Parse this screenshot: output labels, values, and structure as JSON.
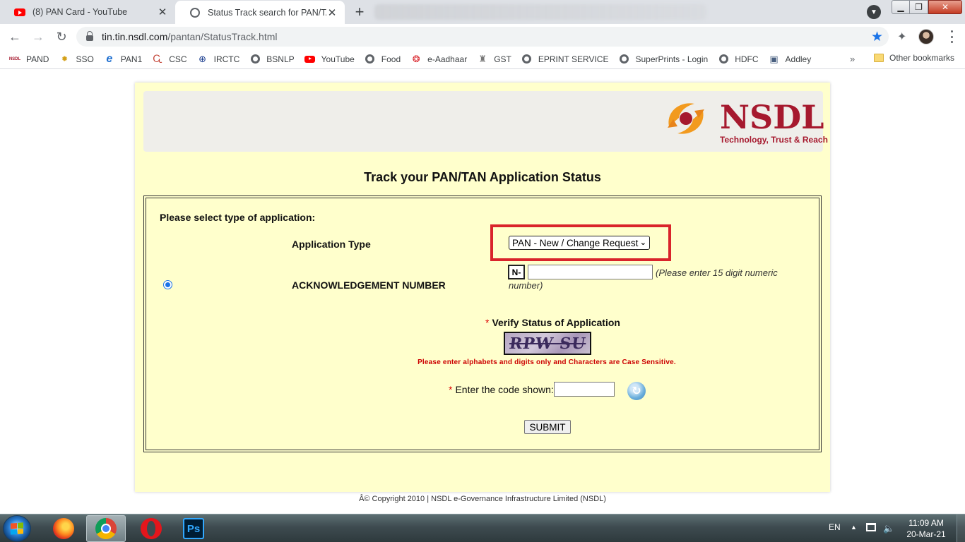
{
  "browser": {
    "tabs": [
      {
        "title": "(8) PAN Card - YouTube",
        "icon": "youtube-icon",
        "active": false
      },
      {
        "title": "Status Track search for PAN/TAN",
        "icon": "globe-icon",
        "active": true
      }
    ],
    "new_tab_symbol": "+",
    "close_symbol": "✕",
    "url_host": "tin.tin.nsdl.com",
    "url_path": "/pantan/StatusTrack.html",
    "bookmarks": [
      {
        "label": "PAND",
        "icon": "nsdl-icon"
      },
      {
        "label": "SSO",
        "icon": "emblem-icon"
      },
      {
        "label": "PAN1",
        "icon": "ie-icon"
      },
      {
        "label": "CSC",
        "icon": "csc-icon"
      },
      {
        "label": "IRCTC",
        "icon": "irctc-icon"
      },
      {
        "label": "BSNLP",
        "icon": "globe-icon"
      },
      {
        "label": "YouTube",
        "icon": "youtube-icon"
      },
      {
        "label": "Food",
        "icon": "globe-icon"
      },
      {
        "label": "e-Aadhaar",
        "icon": "aadhaar-icon"
      },
      {
        "label": "GST",
        "icon": "emblem-icon"
      },
      {
        "label": "EPRINT SERVICE",
        "icon": "globe-icon"
      },
      {
        "label": "SuperPrints - Login",
        "icon": "globe-icon"
      },
      {
        "label": "HDFC",
        "icon": "globe-icon"
      },
      {
        "label": "Addley",
        "icon": "addley-icon"
      }
    ],
    "more_bookmarks": "»",
    "other_bookmarks": "Other bookmarks"
  },
  "page": {
    "logo": {
      "word": "NSDL",
      "tagline": "Technology, Trust & Reach",
      "color": "#a6192e"
    },
    "heading": "Track your PAN/TAN Application Status",
    "select_type_label": "Please select type of application:",
    "application_type_label": "Application Type",
    "application_type_value": "PAN - New / Change Request",
    "ack_label": "ACKNOWLEDGEMENT NUMBER",
    "ack_prefix": "N-",
    "ack_value": "",
    "ack_hint": "(Please enter 15 digit numeric number)",
    "verify_title": "Verify Status of Application",
    "required_mark": "*",
    "captcha_text": "RPW SU",
    "case_note": "Please enter alphabets and digits only and Characters are Case Sensitive.",
    "code_label": "Enter the code shown:",
    "code_value": "",
    "submit_label": "SUBMIT",
    "footer": "Â© Copyright 2010  |  NSDL e-Governance Infrastructure Limited (NSDL)",
    "highlight_color": "#d9242b"
  },
  "taskbar": {
    "apps": [
      "firefox-icon",
      "chrome-icon",
      "opera-icon",
      "photoshop-icon"
    ],
    "photoshop_label": "Ps",
    "language": "EN",
    "time": "11:09 AM",
    "date": "20-Mar-21"
  }
}
